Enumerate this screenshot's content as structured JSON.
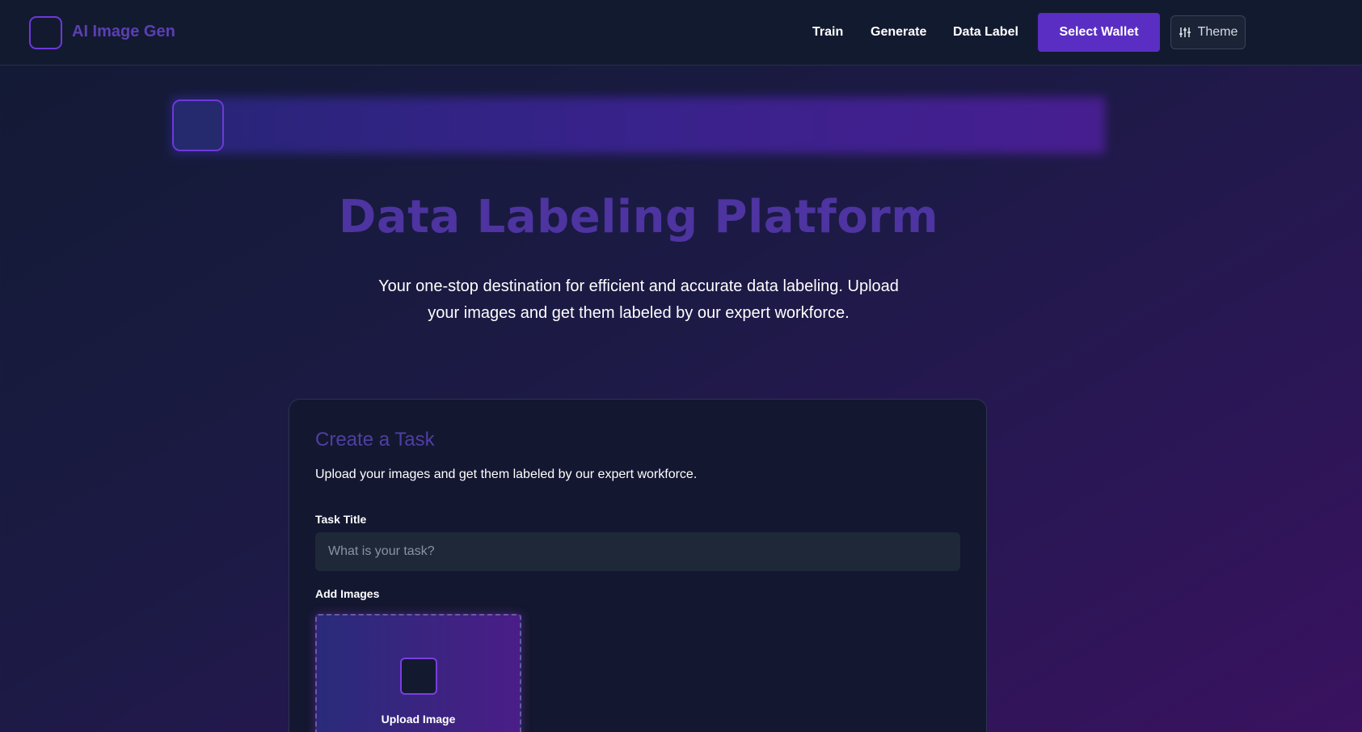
{
  "header": {
    "brand": "AI Image Gen",
    "nav": [
      "Train",
      "Generate",
      "Data Label"
    ],
    "wallet_button": "Select Wallet",
    "theme_button": "Theme",
    "theme_icon": "sliders-icon"
  },
  "hero": {
    "title": "Data Labeling Platform",
    "subtitle": "Your one-stop destination for efficient and accurate data labeling. Upload your images and get them labeled by our expert workforce."
  },
  "card": {
    "title": "Create a Task",
    "description": "Upload your images and get them labeled by our expert workforce.",
    "task_title_label": "Task Title",
    "task_title_placeholder": "What is your task?",
    "task_title_value": "",
    "add_images_label": "Add Images",
    "upload_label": "Upload Image"
  },
  "colors": {
    "accent": "#5a2ec2",
    "brand_text": "#5b3fb3",
    "border_accent": "#6d38d8"
  }
}
